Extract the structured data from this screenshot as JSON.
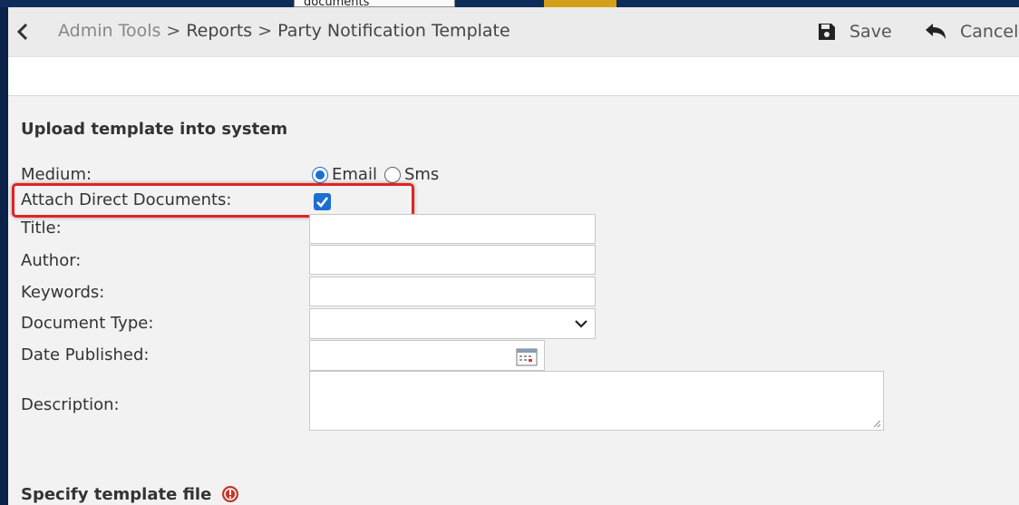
{
  "background": {
    "partial_tab_text": "documents"
  },
  "toolbar": {
    "back_icon": "chevron-left-icon",
    "breadcrumb": [
      "Admin Tools",
      "Reports",
      "Party Notification Template"
    ],
    "separator": ">",
    "save_label": "Save",
    "save_icon": "floppy-disk-icon",
    "cancel_label": "Cancel",
    "cancel_icon": "undo-arrow-icon"
  },
  "form": {
    "section_title": "Upload template into system",
    "medium": {
      "label": "Medium:",
      "options": [
        {
          "label": "Email",
          "selected": true
        },
        {
          "label": "Sms",
          "selected": false
        }
      ]
    },
    "attach_direct_documents": {
      "label": "Attach Direct Documents:",
      "checked": true
    },
    "title": {
      "label": "Title:",
      "value": ""
    },
    "author": {
      "label": "Author:",
      "value": ""
    },
    "keywords": {
      "label": "Keywords:",
      "value": ""
    },
    "document_type": {
      "label": "Document Type:",
      "selected": ""
    },
    "date_published": {
      "label": "Date Published:",
      "value": ""
    },
    "description": {
      "label": "Description:",
      "value": ""
    }
  },
  "specify_section": {
    "title": "Specify template file",
    "icon": "alert-circle-icon"
  },
  "colors": {
    "accent": "#1a6fd1",
    "highlight": "#e52222",
    "page_bg": "#f2f2f2",
    "toolbar_bg": "#ebebeb",
    "frame": "#0d2a57"
  }
}
